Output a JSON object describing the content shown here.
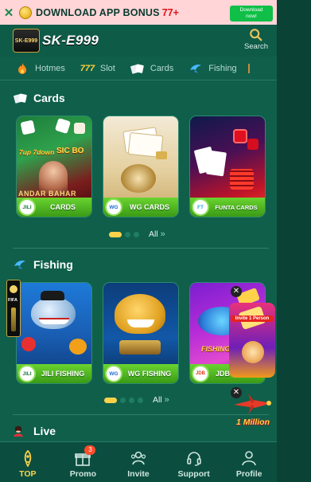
{
  "banner": {
    "close_glyph": "✕",
    "text": "DOWNLOAD APP BONUS",
    "amount": "77+",
    "button_label_line1": "Download",
    "button_label_line2": "now!"
  },
  "header": {
    "logo_text": "SK-E999",
    "logo_small": "SK-E999",
    "search_label": "Search"
  },
  "nav": {
    "items": [
      {
        "label": "Hotmes",
        "icon": "flame-icon"
      },
      {
        "label": "Slot",
        "icon": "slot-777-icon"
      },
      {
        "label": "Cards",
        "icon": "cards-icon"
      },
      {
        "label": "Fishing",
        "icon": "fish-icon"
      }
    ]
  },
  "sections": {
    "cards": {
      "title": "Cards",
      "games": [
        {
          "label": "CARDS",
          "badge": "JILI"
        },
        {
          "label": "WG CARDS",
          "badge": "WG"
        },
        {
          "label": "FUNTA CARDS",
          "badge": "FT"
        }
      ],
      "art_text": {
        "game1a": "7up 7down",
        "game1b": "SIC BO",
        "game1c": "ANDAR BAHAR"
      },
      "all_label": "All"
    },
    "fishing": {
      "title": "Fishing",
      "games": [
        {
          "label": "JILI FISHING",
          "badge": "JILI"
        },
        {
          "label": "WG FISHING",
          "badge": "WG"
        },
        {
          "label": "JDB",
          "badge": "JDB"
        }
      ],
      "art_text": {
        "game3": "FISHING DIS"
      },
      "all_label": "All"
    },
    "live": {
      "title": "Live"
    }
  },
  "floating": {
    "promo1_text": "Invite 1 Person",
    "promo2_text": "1 Million",
    "left_tag": "FIFA",
    "close_glyph": "✕"
  },
  "footer": {
    "items": [
      {
        "label": "TOP",
        "icon": "rocket-icon",
        "active": true
      },
      {
        "label": "Promo",
        "icon": "gift-icon",
        "badge": "3"
      },
      {
        "label": "Invite",
        "icon": "users-icon"
      },
      {
        "label": "Support",
        "icon": "headset-icon"
      },
      {
        "label": "Profile",
        "icon": "profile-icon"
      }
    ]
  },
  "colors": {
    "background": "#0f5f4b",
    "accent": "#ffd24a",
    "label_green": "#5ccf25",
    "banner_bg": "#ffd5d8"
  }
}
